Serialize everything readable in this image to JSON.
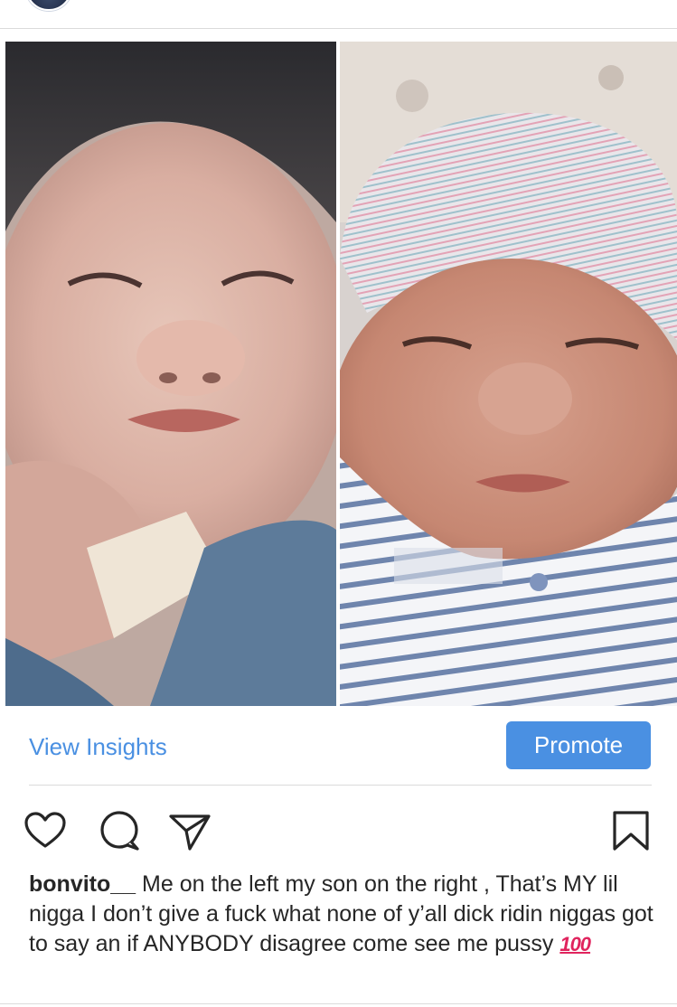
{
  "post": {
    "photos": [
      {
        "description": "newborn-photo-left"
      },
      {
        "description": "newborn-photo-right"
      }
    ]
  },
  "insights": {
    "view_insights_label": "View Insights",
    "promote_label": "Promote"
  },
  "actions": {
    "icons": [
      "heart-icon",
      "comment-icon",
      "paper-plane-icon",
      "bookmark-icon"
    ]
  },
  "caption": {
    "username": "bonvito__",
    "text": " Me on the left my son on the right , That’s MY lil nigga I don’t give a fuck what none of y’all dick ridin niggas got to say an if ANYBODY disagree come see me pussy ",
    "emoji": "100"
  },
  "colors": {
    "accent": "#4a90e2",
    "text": "#262626",
    "divider": "#dbdbdb",
    "emoji": "#e0245e"
  }
}
